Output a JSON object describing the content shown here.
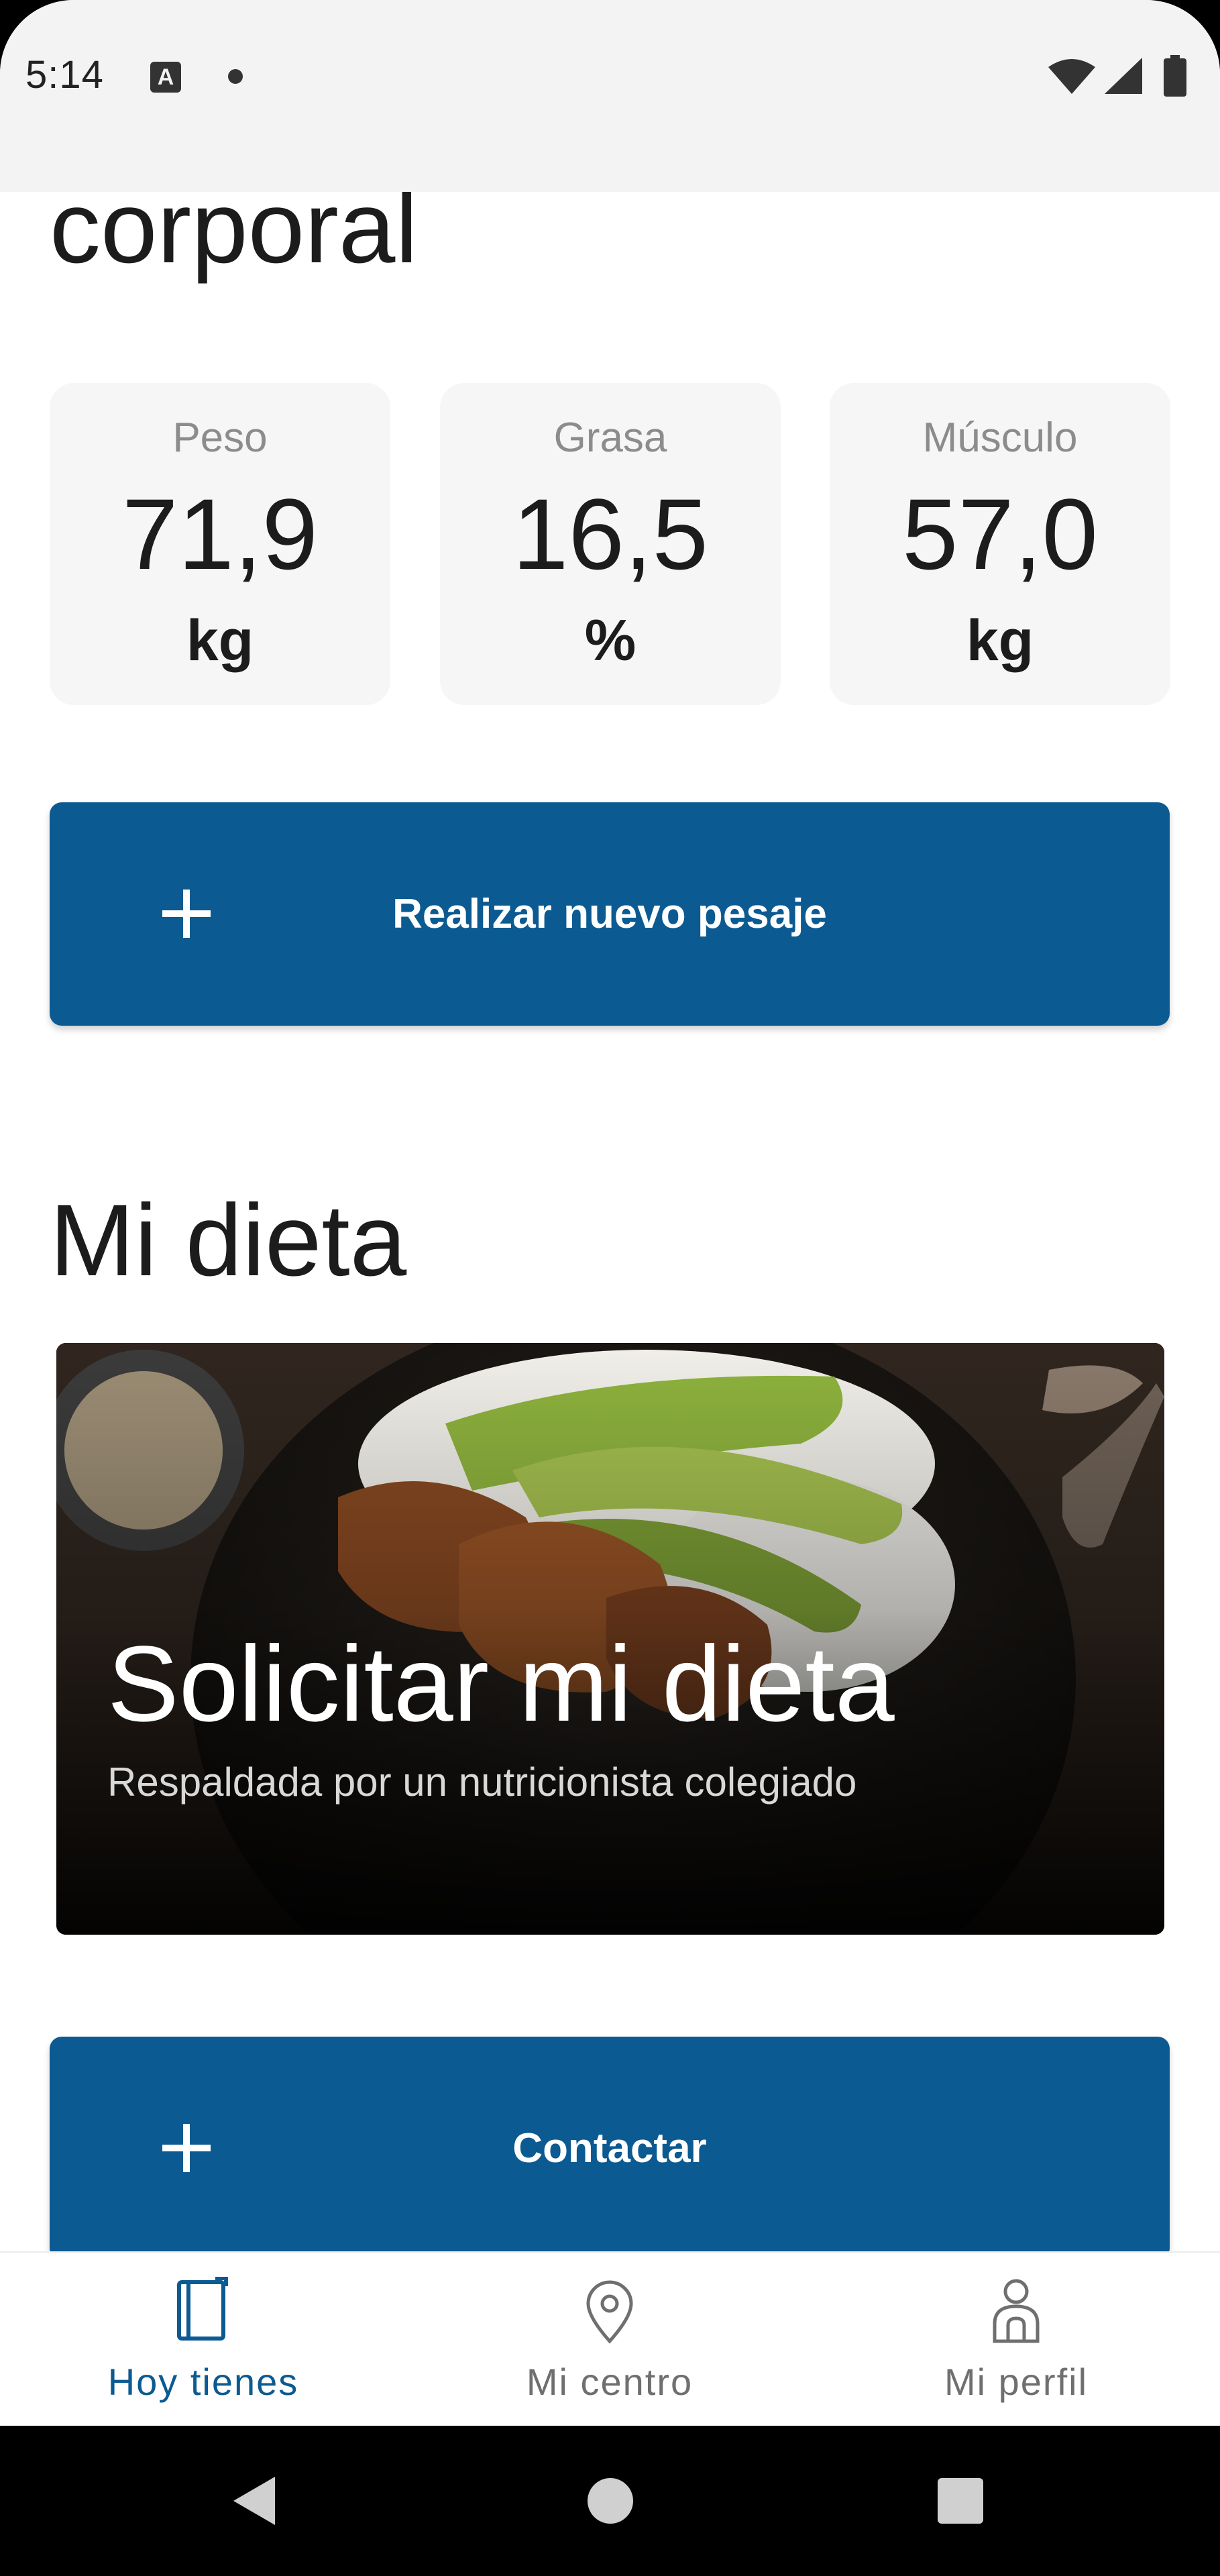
{
  "status_bar": {
    "time": "5:14",
    "notification_icon": "A",
    "icons": [
      "wifi-icon",
      "signal-icon",
      "battery-icon"
    ]
  },
  "body_section": {
    "title": "corporal",
    "stats": [
      {
        "label": "Peso",
        "value": "71,9",
        "unit": "kg"
      },
      {
        "label": "Grasa",
        "value": "16,5",
        "unit": "%"
      },
      {
        "label": "Músculo",
        "value": "57,0",
        "unit": "kg"
      }
    ],
    "new_weighing_button": "Realizar nuevo pesaje"
  },
  "diet_section": {
    "title": "Mi dieta",
    "card_title": "Solicitar mi dieta",
    "card_subtitle": "Respaldada por un nutricionista colegiado",
    "contact_button": "Contactar"
  },
  "bottom_nav": {
    "items": [
      {
        "label": "Hoy tienes",
        "icon": "notebook-icon",
        "active": true
      },
      {
        "label": "Mi centro",
        "icon": "location-pin-icon",
        "active": false
      },
      {
        "label": "Mi perfil",
        "icon": "person-icon",
        "active": false
      }
    ]
  },
  "colors": {
    "primary": "#0b5a92",
    "active_nav": "#0b5a92",
    "inactive_nav": "#6f6f6f",
    "card_bg": "#f6f6f6"
  }
}
